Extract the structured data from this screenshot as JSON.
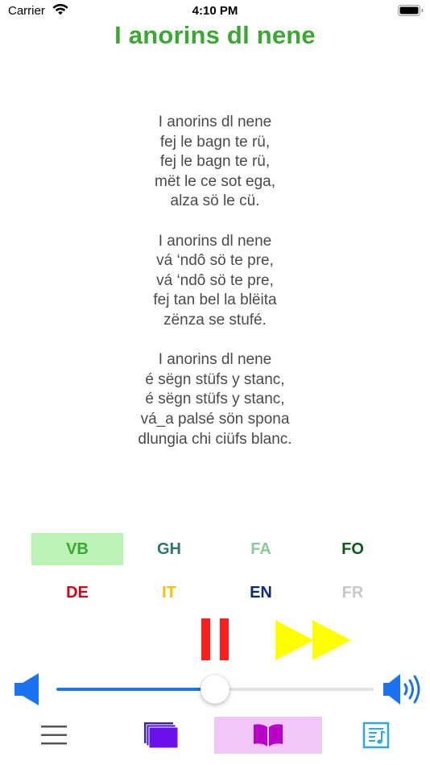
{
  "status_bar": {
    "carrier": "Carrier",
    "time": "4:10 PM"
  },
  "song": {
    "title": "I anorins dl nene",
    "title_color": "#3aa832",
    "stanzas": [
      [
        "I anorins dl nene",
        "fej le bagn te rü,",
        "fej le bagn te rü,",
        "mët le ce sot ega,",
        "alza sö le cü."
      ],
      [
        "I anorins dl nene",
        "vá ‘ndô sö te pre,",
        "vá ‘ndô sö te pre,",
        "fej tan bel la blëita",
        "zënza se stufé."
      ],
      [
        "I anorins dl nene",
        "é sëgn stüfs y stanc,",
        "é sëgn stüfs y stanc,",
        "vá_a palsé sön spona",
        "dlungia chi ciüfs blanc."
      ]
    ]
  },
  "languages": [
    {
      "code": "VB",
      "color": "#3aa832",
      "selected": true,
      "selected_bg": "#b9f4b4"
    },
    {
      "code": "GH",
      "color": "#2a7a6a",
      "selected": false
    },
    {
      "code": "FA",
      "color": "#8cc99a",
      "selected": false
    },
    {
      "code": "FO",
      "color": "#0e5a1e",
      "selected": false
    },
    {
      "code": "DE",
      "color": "#d0021b",
      "selected": false
    },
    {
      "code": "IT",
      "color": "#f5c000",
      "selected": false
    },
    {
      "code": "EN",
      "color": "#0a2d6e",
      "selected": false
    },
    {
      "code": "FR",
      "color": "#c8c8c8",
      "selected": false
    }
  ],
  "playback": {
    "pause_icon": "pause-icon",
    "pause_color": "#ff1e1e",
    "fast_forward_icon": "fast-forward-icon",
    "fast_forward_color": "#ffff00"
  },
  "volume": {
    "level": 0.5,
    "low_icon": "speaker-low-icon",
    "high_icon": "speaker-high-icon",
    "accent": "#1a73f0"
  },
  "tab_bar": {
    "tabs": [
      {
        "icon": "menu-icon",
        "selected": false
      },
      {
        "icon": "stack-icon",
        "selected": false
      },
      {
        "icon": "book-icon",
        "selected": true,
        "selected_bg": "#f2c6f8"
      },
      {
        "icon": "music-sheet-icon",
        "selected": false
      }
    ]
  }
}
